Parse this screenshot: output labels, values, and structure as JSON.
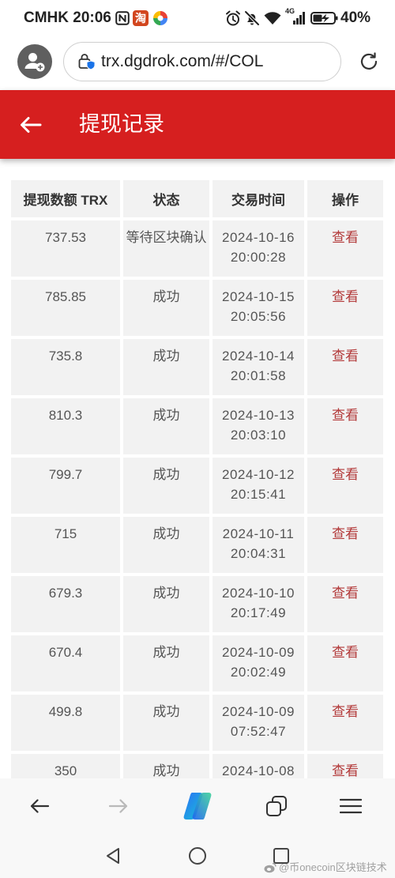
{
  "status_bar": {
    "carrier": "CMHK",
    "time": "20:06",
    "left_icons": [
      "nfc-icon",
      "taobao-icon",
      "pinwheel-app-icon"
    ],
    "taobao_glyph": "淘",
    "right_icons": [
      "alarm-icon",
      "mute-bell-icon",
      "wifi-icon",
      "signal-icon",
      "battery-icon"
    ],
    "network_type": "4G",
    "battery": "40%"
  },
  "browser": {
    "url": "trx.dgdrok.com/#/COL",
    "icons": [
      "profile-avatar-icon",
      "site-security-icon",
      "refresh-icon"
    ]
  },
  "header": {
    "title": "提现记录",
    "back_icon": "arrow-left-icon"
  },
  "table": {
    "columns": [
      "提现数额 TRX",
      "状态",
      "交易时间",
      "操作"
    ],
    "rows": [
      {
        "amount": "737.53",
        "status": "等待区块确认",
        "date": "2024-10-16",
        "time": "20:00:28",
        "action": "查看"
      },
      {
        "amount": "785.85",
        "status": "成功",
        "date": "2024-10-15",
        "time": "20:05:56",
        "action": "查看"
      },
      {
        "amount": "735.8",
        "status": "成功",
        "date": "2024-10-14",
        "time": "20:01:58",
        "action": "查看"
      },
      {
        "amount": "810.3",
        "status": "成功",
        "date": "2024-10-13",
        "time": "20:03:10",
        "action": "查看"
      },
      {
        "amount": "799.7",
        "status": "成功",
        "date": "2024-10-12",
        "time": "20:15:41",
        "action": "查看"
      },
      {
        "amount": "715",
        "status": "成功",
        "date": "2024-10-11",
        "time": "20:04:31",
        "action": "查看"
      },
      {
        "amount": "679.3",
        "status": "成功",
        "date": "2024-10-10",
        "time": "20:17:49",
        "action": "查看"
      },
      {
        "amount": "670.4",
        "status": "成功",
        "date": "2024-10-09",
        "time": "20:02:49",
        "action": "查看"
      },
      {
        "amount": "499.8",
        "status": "成功",
        "date": "2024-10-09",
        "time": "07:52:47",
        "action": "查看"
      },
      {
        "amount": "350",
        "status": "成功",
        "date": "2024-10-08",
        "action": "查看"
      }
    ]
  },
  "toolbar": {
    "icons": [
      "back-arrow-icon",
      "forward-arrow-icon",
      "copilot-icon",
      "tabs-icon",
      "menu-icon"
    ],
    "forward_enabled": false
  },
  "nav_bar": {
    "icons": [
      "nav-back-icon",
      "nav-home-icon",
      "nav-recents-icon"
    ]
  },
  "watermark": "@币onecoin区块链技术",
  "colors": {
    "header_red": "#d61f1f",
    "action_red": "#b33a3a",
    "cell_bg": "#f2f2f2",
    "cell_text": "#555555",
    "header_text": "#333333"
  }
}
